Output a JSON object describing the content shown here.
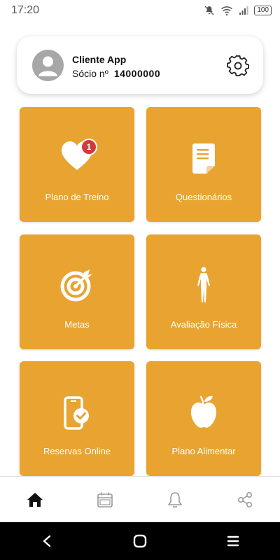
{
  "status_bar": {
    "time": "17:20",
    "battery": "100",
    "icons": [
      "mute-icon",
      "wifi-icon",
      "signal-icon",
      "battery-icon"
    ]
  },
  "profile": {
    "name": "Cliente App",
    "member_label": "Sócio nº",
    "member_number": "14000000",
    "avatar_icon": "user-avatar-icon",
    "settings_icon": "gear-icon"
  },
  "tiles": [
    {
      "label": "Plano de Treino",
      "icon": "heart-icon",
      "badge": "1"
    },
    {
      "label": "Questionários",
      "icon": "document-icon"
    },
    {
      "label": "Metas",
      "icon": "target-icon"
    },
    {
      "label": "Avaliação Física",
      "icon": "human-body-icon"
    },
    {
      "label": "Reservas Online",
      "icon": "phone-check-icon"
    },
    {
      "label": "Plano Alimentar",
      "icon": "apple-icon"
    }
  ],
  "bottom_nav": [
    {
      "icon": "home-icon",
      "active": true
    },
    {
      "icon": "calendar-icon",
      "active": false
    },
    {
      "icon": "bell-icon",
      "active": false
    },
    {
      "icon": "share-icon",
      "active": false
    }
  ],
  "system_nav": [
    "back-icon",
    "home-circle-icon",
    "recents-icon"
  ],
  "colors": {
    "tile": "#e8a331",
    "badge": "#d13b3b",
    "avatar": "#a7a7a7",
    "nav_inactive": "#9a9a9a"
  }
}
